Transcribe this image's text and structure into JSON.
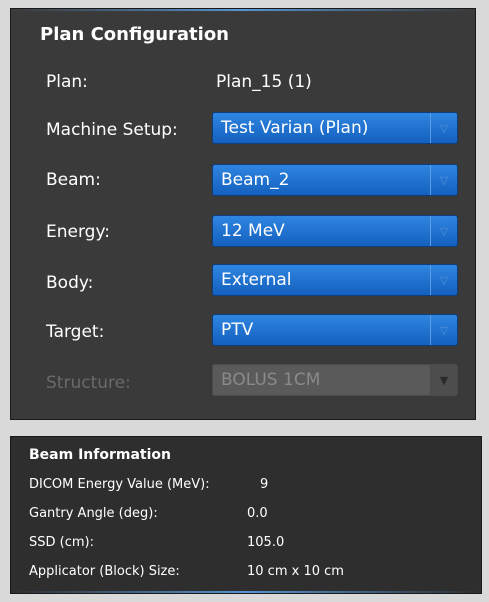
{
  "plan_configuration": {
    "title": "Plan Configuration",
    "plan": {
      "label": "Plan:",
      "value": "Plan_15 (1)"
    },
    "machine_setup": {
      "label": "Machine Setup:",
      "value": "Test Varian (Plan)"
    },
    "beam": {
      "label": "Beam:",
      "value": "Beam_2"
    },
    "energy": {
      "label": "Energy:",
      "value": "12 MeV"
    },
    "body": {
      "label": "Body:",
      "value": "External"
    },
    "target": {
      "label": "Target:",
      "value": "PTV"
    },
    "structure": {
      "label": "Structure:",
      "value": "BOLUS 1CM",
      "disabled": true
    },
    "dropdown_icon": "chevron-down-icon"
  },
  "beam_information": {
    "title": "Beam Information",
    "rows": [
      {
        "label": "DICOM Energy Value (MeV):",
        "value": "9"
      },
      {
        "label": "Gantry Angle (deg):",
        "value": "0.0"
      },
      {
        "label": "SSD (cm):",
        "value": "105.0"
      },
      {
        "label": "Applicator (Block) Size:",
        "value": "10 cm x 10 cm"
      }
    ]
  },
  "colors": {
    "panel_background": "#2e2e2e",
    "dropdown_blue": "#1e6fd0",
    "disabled_gray": "#5a5a5a",
    "accent_glow": "#5aa0e6"
  }
}
